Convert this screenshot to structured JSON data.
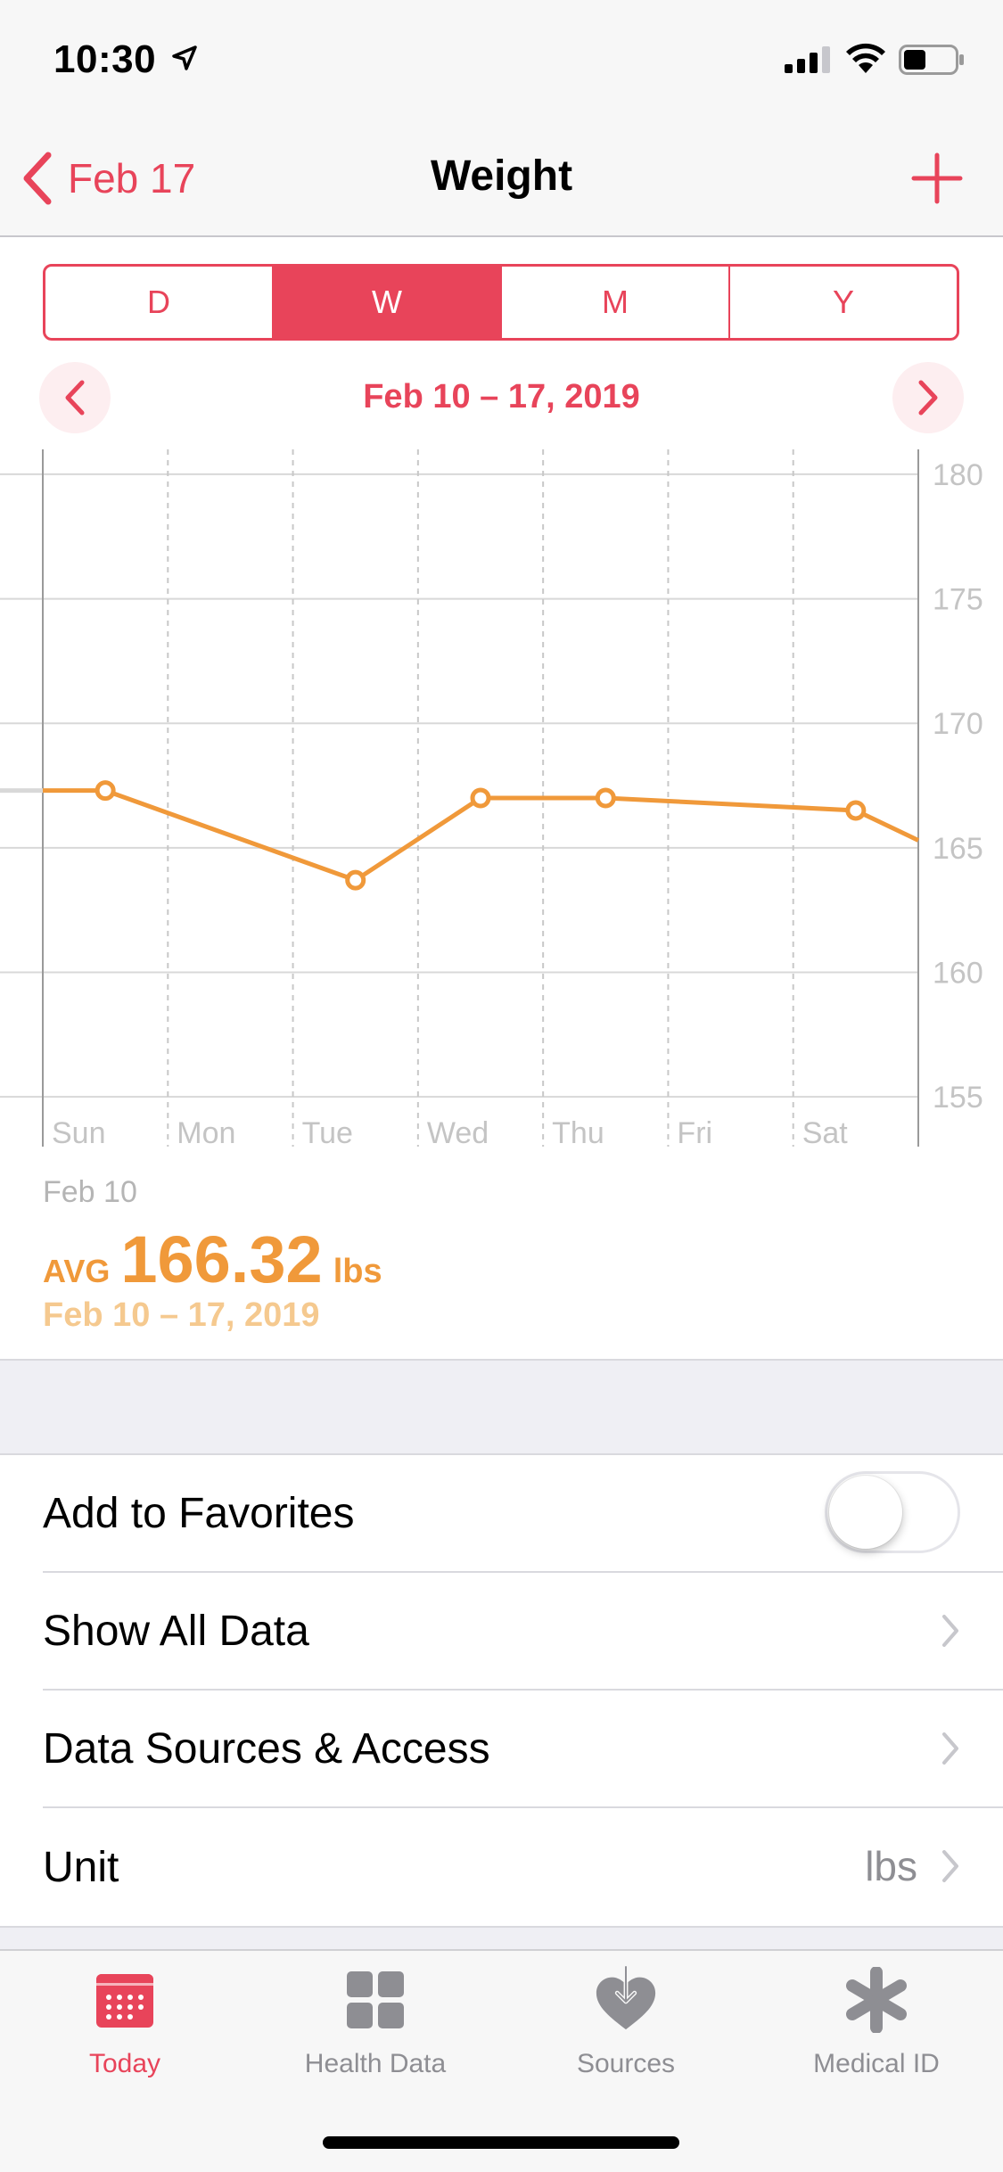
{
  "status_bar": {
    "time": "10:30"
  },
  "nav": {
    "back_label": "Feb 17",
    "title": "Weight"
  },
  "segments": [
    {
      "label": "D",
      "active": false
    },
    {
      "label": "W",
      "active": true
    },
    {
      "label": "M",
      "active": false
    },
    {
      "label": "Y",
      "active": false
    }
  ],
  "range_label": "Feb 10 – 17, 2019",
  "chart_data": {
    "type": "line",
    "x": [
      "Sun",
      "Mon",
      "Tue",
      "Wed",
      "Thu",
      "Fri",
      "Sat"
    ],
    "first_date_label": "Feb 10",
    "ylim": [
      153,
      181
    ],
    "yticks": [
      180,
      175,
      170,
      165,
      160,
      155
    ],
    "series": [
      {
        "color": "#f0993a",
        "points": [
          {
            "x": 0.5,
            "y": 167.3
          },
          {
            "x": 2.5,
            "y": 163.7
          },
          {
            "x": 3.5,
            "y": 167.0
          },
          {
            "x": 4.5,
            "y": 167.0
          },
          {
            "x": 6.5,
            "y": 166.5
          }
        ],
        "extends_before": 167.3,
        "extends_after": 165.3
      }
    ],
    "grid": true
  },
  "summary": {
    "avg_label": "AVG",
    "avg_value": "166.32",
    "avg_unit": "lbs",
    "avg_range": "Feb 10 – 17, 2019"
  },
  "settings": {
    "favorites": {
      "label": "Add to Favorites",
      "on": false
    },
    "show_all": {
      "label": "Show All Data"
    },
    "sources": {
      "label": "Data Sources & Access"
    },
    "unit": {
      "label": "Unit",
      "value": "lbs"
    }
  },
  "tabs": [
    {
      "label": "Today",
      "icon": "calendar-icon",
      "active": true
    },
    {
      "label": "Health Data",
      "icon": "grid-icon",
      "active": false
    },
    {
      "label": "Sources",
      "icon": "heart-download-icon",
      "active": false
    },
    {
      "label": "Medical ID",
      "icon": "asterisk-icon",
      "active": false
    }
  ],
  "colors": {
    "accent": "#e8445a",
    "series": "#f0993a"
  }
}
